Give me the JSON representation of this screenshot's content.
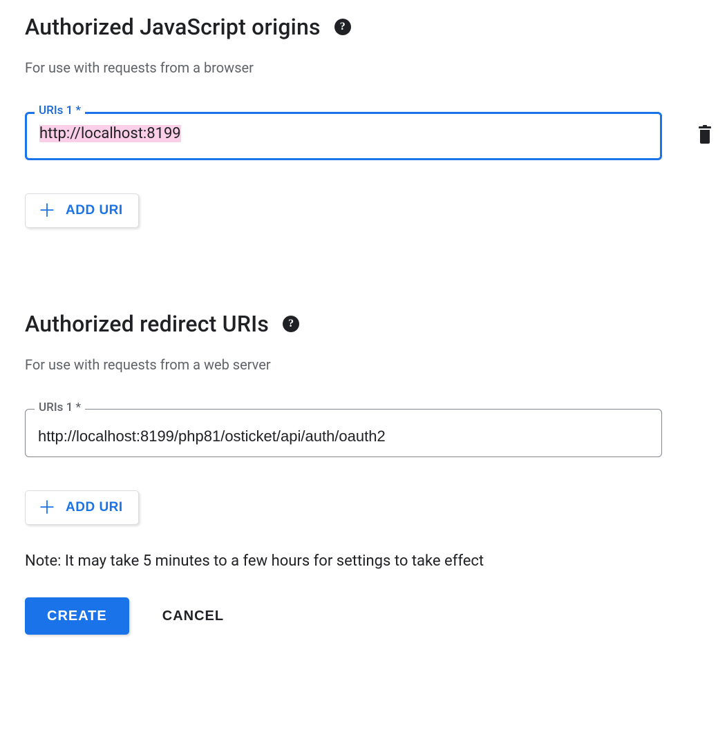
{
  "js_origins": {
    "title": "Authorized JavaScript origins",
    "subtitle": "For use with requests from a browser",
    "field_label": "URIs 1 *",
    "value": "http://localhost:8199",
    "add_label": "ADD URI"
  },
  "redirect_uris": {
    "title": "Authorized redirect URIs",
    "subtitle": "For use with requests from a web server",
    "field_label": "URIs 1 *",
    "value": "http://localhost:8199/php81/osticket/api/auth/oauth2",
    "add_label": "ADD URI"
  },
  "note": "Note: It may take 5 minutes to a few hours for settings to take effect",
  "buttons": {
    "create": "CREATE",
    "cancel": "CANCEL"
  }
}
